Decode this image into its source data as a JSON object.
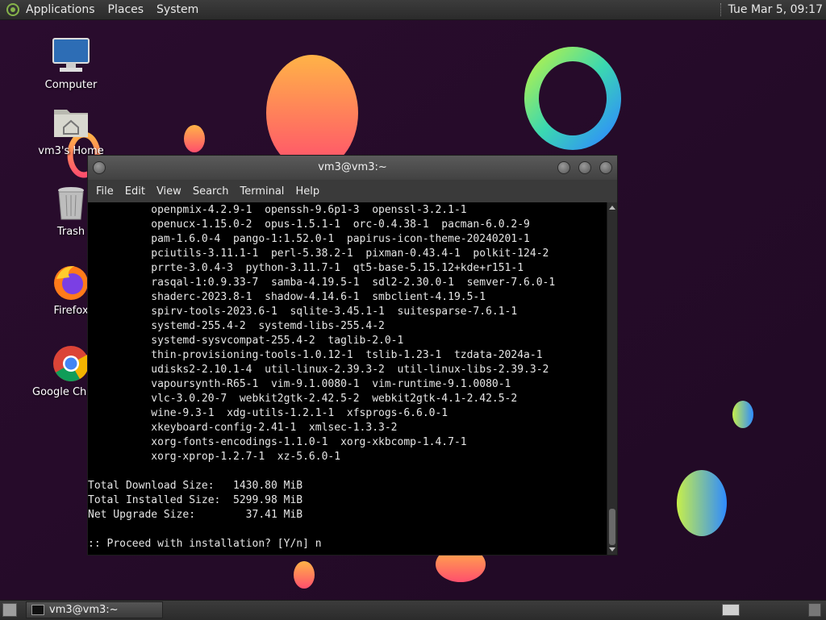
{
  "top_panel": {
    "menus": [
      "Applications",
      "Places",
      "System"
    ],
    "clock": "Tue Mar  5, 09:17"
  },
  "desktop_icons": [
    {
      "label": "Computer",
      "icon": "computer-icon"
    },
    {
      "label": "vm3's Home",
      "icon": "home-folder-icon"
    },
    {
      "label": "Trash",
      "icon": "trash-icon"
    },
    {
      "label": "Firefox",
      "icon": "firefox-icon"
    },
    {
      "label": "Google Chrome",
      "icon": "chrome-icon"
    }
  ],
  "terminal": {
    "title": "vm3@vm3:~",
    "menu": [
      "File",
      "Edit",
      "View",
      "Search",
      "Terminal",
      "Help"
    ],
    "lines": [
      "          openpmix-4.2.9-1  openssh-9.6p1-3  openssl-3.2.1-1",
      "          openucx-1.15.0-2  opus-1.5.1-1  orc-0.4.38-1  pacman-6.0.2-9",
      "          pam-1.6.0-4  pango-1:1.52.0-1  papirus-icon-theme-20240201-1",
      "          pciutils-3.11.1-1  perl-5.38.2-1  pixman-0.43.4-1  polkit-124-2",
      "          prrte-3.0.4-3  python-3.11.7-1  qt5-base-5.15.12+kde+r151-1",
      "          rasqal-1:0.9.33-7  samba-4.19.5-1  sdl2-2.30.0-1  semver-7.6.0-1",
      "          shaderc-2023.8-1  shadow-4.14.6-1  smbclient-4.19.5-1",
      "          spirv-tools-2023.6-1  sqlite-3.45.1-1  suitesparse-7.6.1-1",
      "          systemd-255.4-2  systemd-libs-255.4-2",
      "          systemd-sysvcompat-255.4-2  taglib-2.0-1",
      "          thin-provisioning-tools-1.0.12-1  tslib-1.23-1  tzdata-2024a-1",
      "          udisks2-2.10.1-4  util-linux-2.39.3-2  util-linux-libs-2.39.3-2",
      "          vapoursynth-R65-1  vim-9.1.0080-1  vim-runtime-9.1.0080-1",
      "          vlc-3.0.20-7  webkit2gtk-2.42.5-2  webkit2gtk-4.1-2.42.5-2",
      "          wine-9.3-1  xdg-utils-1.2.1-1  xfsprogs-6.6.0-1",
      "          xkeyboard-config-2.41-1  xmlsec-1.3.3-2",
      "          xorg-fonts-encodings-1.1.0-1  xorg-xkbcomp-1.4.7-1",
      "          xorg-xprop-1.2.7-1  xz-5.6.0-1",
      "",
      "Total Download Size:   1430.80 MiB",
      "Total Installed Size:  5299.98 MiB",
      "Net Upgrade Size:        37.41 MiB",
      "",
      ":: Proceed with installation? [Y/n] n"
    ]
  },
  "taskbar": {
    "task_label": "vm3@vm3:~"
  },
  "colors": {
    "wallpaper": "#2a0f2c",
    "terminal_bg": "#000000",
    "terminal_fg": "#e6e6e6",
    "panel": "#333333"
  }
}
